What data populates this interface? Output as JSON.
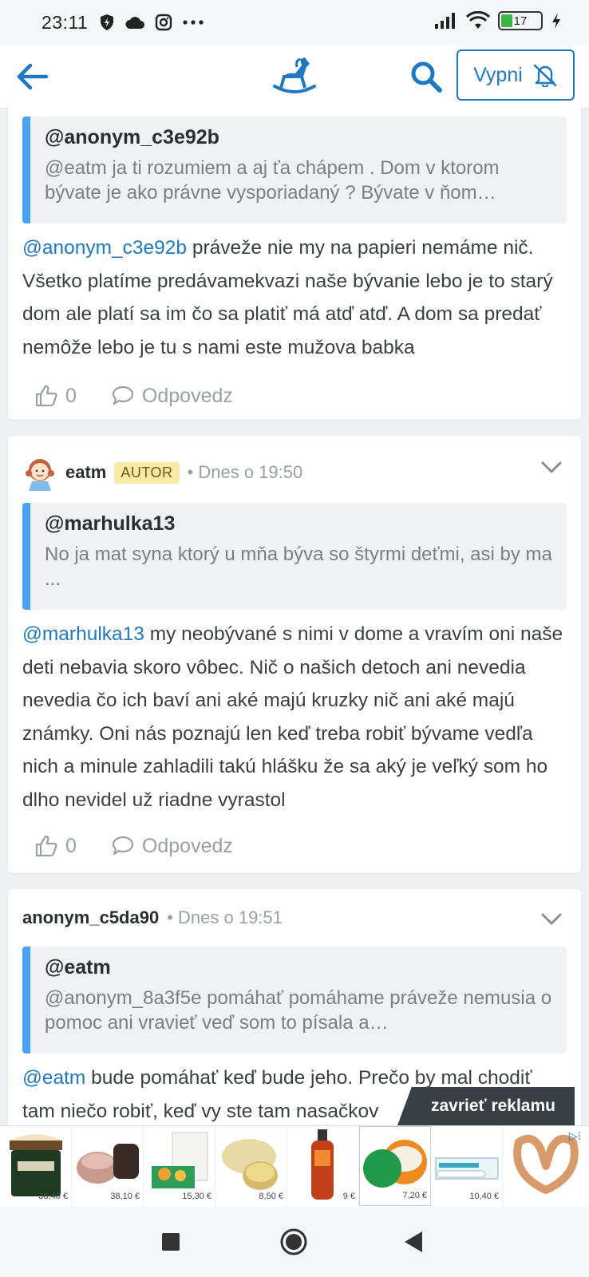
{
  "status": {
    "time": "23:11",
    "battery": "17"
  },
  "appbar": {
    "mute_label": "Vypni"
  },
  "comments": [
    {
      "quote_name": "@anonym_c3e92b",
      "quote_text": "@eatm ja ti rozumiem a aj ťa chápem . Dom v ktorom bývate je ako právne vysporiadaný ? Bývate v ňom…",
      "mention": "@anonym_c3e92b",
      "text": " práveže nie my na papieri nemáme nič. Všetko platíme predávamekvazi naše bývanie lebo je to starý dom ale platí sa im čo sa platiť má atď atď. A dom sa predať nemôže lebo je tu s nami este mužova babka",
      "likes": "0",
      "reply": "Odpovedz"
    },
    {
      "user": "eatm",
      "badge": "AUTOR",
      "time": "• Dnes o 19:50",
      "quote_name": "@marhulka13",
      "quote_text": "No ja mat syna ktorý u mňa býva so štyrmi deťmi, asi by ma ...",
      "mention": "@marhulka13",
      "text": " my neobývané s nimi v dome a vravím oni naše deti nebavia skoro vôbec. Nič o našich detoch ani nevedia nevedia čo ich baví ani aké majú kruzky nič ani aké majú známky. Oni nás poznajú len keď treba robiť bývame vedľa nich a minule zahladili takú hlášku že sa aký je veľký som ho dlho nevidel už riadne vyrastol",
      "likes": "0",
      "reply": "Odpovedz"
    },
    {
      "user": "anonym_c5da90",
      "time": "• Dnes o 19:51",
      "quote_name": "@eatm",
      "quote_text": "@anonym_8a3f5e pomáhať pomáhame práveže nemusia o pomoc ani vravieť veď som to písala a…",
      "mention": "@eatm",
      "text": " bude pomáhať keď bude jeho. Prečo by mal chodiť tam niečo robiť, keď vy ste tam nasačkov"
    }
  ],
  "ad": {
    "close_label": "zavrieť reklamu",
    "prices": [
      "36,40 €",
      "38,10 €",
      "15,30 €",
      "8,50 €",
      "9 €",
      "7,20 €",
      "10,40 €"
    ]
  }
}
